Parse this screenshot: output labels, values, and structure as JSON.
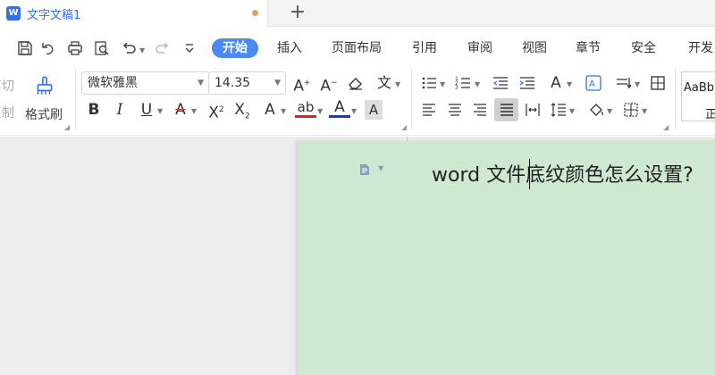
{
  "tabs": {
    "app_icon_glyph": "W",
    "document_tab": "文字文稿1",
    "new_tab_glyph": "+"
  },
  "menu": {
    "items": [
      "开始",
      "插入",
      "页面布局",
      "引用",
      "审阅",
      "视图",
      "章节",
      "安全",
      "开发"
    ],
    "active_index": 0,
    "active_color": "#4a8af4"
  },
  "ribbon": {
    "clipboard": {
      "cut": "剪切",
      "copy": "复制",
      "format_painter": "格式刷"
    },
    "font": {
      "family": "微软雅黑",
      "size": "14.35"
    },
    "styles": {
      "sample": "AaBb",
      "name": "正"
    }
  },
  "document": {
    "text": "word 文件底纹颜色怎么设置?",
    "page_shading_color": "#cfe8d1"
  },
  "icons": [
    "save-icon",
    "undo-history-icon",
    "print-icon",
    "print-preview-icon",
    "undo-icon",
    "redo-icon",
    "customize-toolbar-icon",
    "format-painter-icon",
    "increase-font-icon",
    "decrease-font-icon",
    "clear-format-icon",
    "pinyin-guide-icon",
    "bold-icon",
    "italic-icon",
    "underline-icon",
    "strikethrough-icon",
    "superscript-icon",
    "subscript-icon",
    "text-effect-icon",
    "highlight-icon",
    "font-color-icon",
    "character-shading-icon",
    "bullets-icon",
    "numbering-icon",
    "decrease-indent-icon",
    "increase-indent-icon",
    "text-direction-icon",
    "chinese-layout-icon",
    "show-marks-icon",
    "borders-table-icon",
    "align-left-icon",
    "align-center-icon",
    "align-right-icon",
    "justify-icon",
    "distribute-icon",
    "line-spacing-icon",
    "shading-icon",
    "border-icon",
    "paragraph-icon"
  ]
}
